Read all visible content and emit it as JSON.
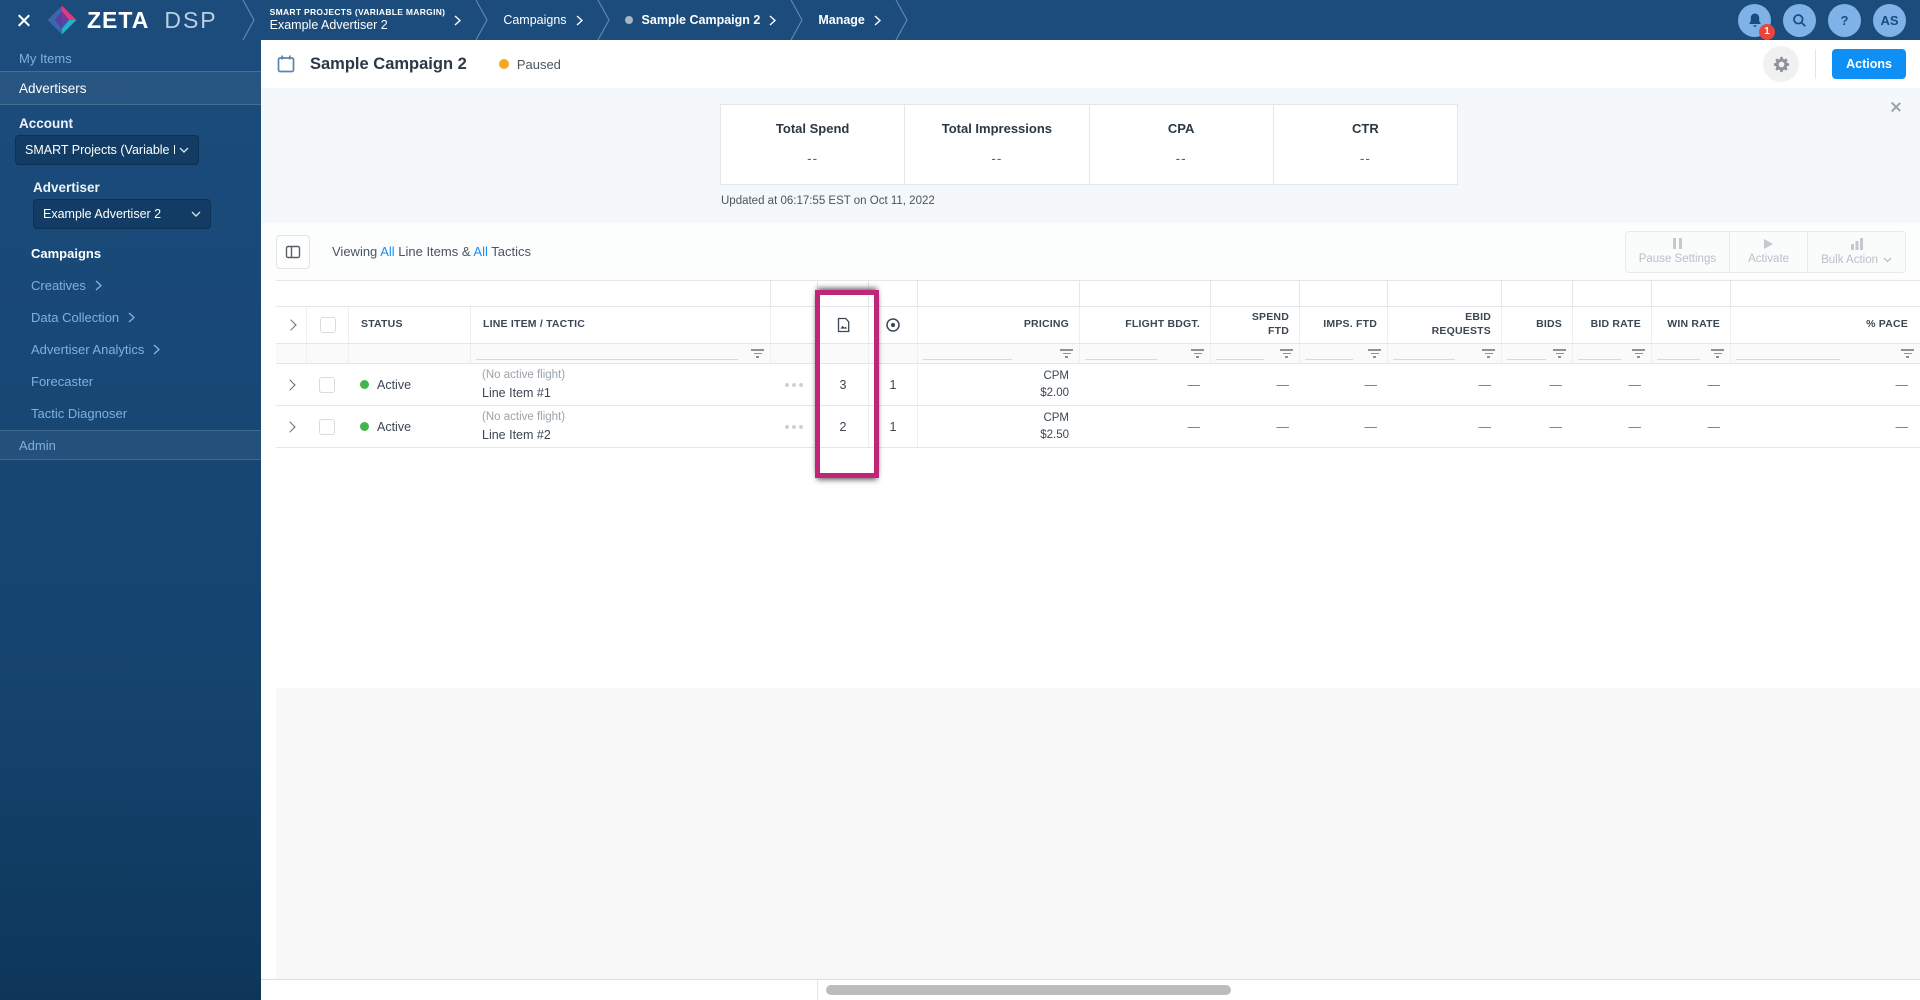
{
  "topbar": {
    "brand": {
      "name": "ZETA",
      "suffix": "DSP"
    },
    "breadcrumbs": [
      {
        "supertitle": "SMART PROJECTS (VARIABLE MARGIN)",
        "label": "Example Advertiser 2"
      },
      {
        "label": "Campaigns"
      },
      {
        "label": "Sample Campaign 2"
      },
      {
        "label": "Manage"
      }
    ],
    "notification_count": "1",
    "help_label": "?",
    "avatar_initials": "AS"
  },
  "sidebar": {
    "my_items": "My Items",
    "advertisers": "Advertisers",
    "account_label": "Account",
    "account_value": "SMART Projects (Variable M...",
    "advertiser_label": "Advertiser",
    "advertiser_value": "Example Advertiser 2",
    "nav": [
      {
        "label": "Campaigns"
      },
      {
        "label": "Creatives"
      },
      {
        "label": "Data Collection"
      },
      {
        "label": "Advertiser Analytics"
      },
      {
        "label": "Forecaster"
      },
      {
        "label": "Tactic Diagnoser"
      }
    ],
    "admin": "Admin"
  },
  "header": {
    "title": "Sample Campaign 2",
    "status": "Paused",
    "actions_label": "Actions"
  },
  "stats": {
    "cards": [
      {
        "label": "Total Spend",
        "value": "--"
      },
      {
        "label": "Total Impressions",
        "value": "--"
      },
      {
        "label": "CPA",
        "value": "--"
      },
      {
        "label": "CTR",
        "value": "--"
      }
    ],
    "updated": "Updated at 06:17:55 EST on Oct 11, 2022"
  },
  "toolbar": {
    "viewing_prefix": "Viewing ",
    "all_1": "All",
    "viewing_mid": " Line Items & ",
    "all_2": "All",
    "viewing_suffix": " Tactics",
    "pause_settings": "Pause Settings",
    "activate": "Activate",
    "bulk_action": "Bulk Action"
  },
  "table": {
    "columns": {
      "status": "STATUS",
      "line_item": "LINE ITEM / TACTIC",
      "pricing": "PRICING",
      "flight_bdgt": "FLIGHT BDGT.",
      "spend_ftd": "SPEND FTD",
      "imps_ftd": "IMPS. FTD",
      "ebid_requests": "EBID REQUESTS",
      "bids": "BIDS",
      "bid_rate": "BID RATE",
      "win_rate": "WIN RATE",
      "pace": "% PACE"
    },
    "rows": [
      {
        "status": "Active",
        "flight_note": "(No active flight)",
        "name": "Line Item #1",
        "creatives": "3",
        "tactics": "1",
        "pricing_type": "CPM",
        "pricing_value": "$2.00",
        "flight_bdgt": "—",
        "spend_ftd": "—",
        "imps_ftd": "—",
        "ebid_requests": "—",
        "bids": "—",
        "bid_rate": "—",
        "win_rate": "—",
        "pace": "—"
      },
      {
        "status": "Active",
        "flight_note": "(No active flight)",
        "name": "Line Item #2",
        "creatives": "2",
        "tactics": "1",
        "pricing_type": "CPM",
        "pricing_value": "$2.50",
        "flight_bdgt": "—",
        "spend_ftd": "—",
        "imps_ftd": "—",
        "ebid_requests": "—",
        "bids": "—",
        "bid_rate": "—",
        "win_rate": "—",
        "pace": "—"
      }
    ]
  },
  "colors": {
    "topbar_blue": "#1b4c7c",
    "accent_blue": "#0d8ff5",
    "link_blue": "#1890f5",
    "paused_orange": "#f5a623",
    "active_green": "#43b649",
    "highlight_pink": "#c02678",
    "badge_red": "#e8453c"
  }
}
